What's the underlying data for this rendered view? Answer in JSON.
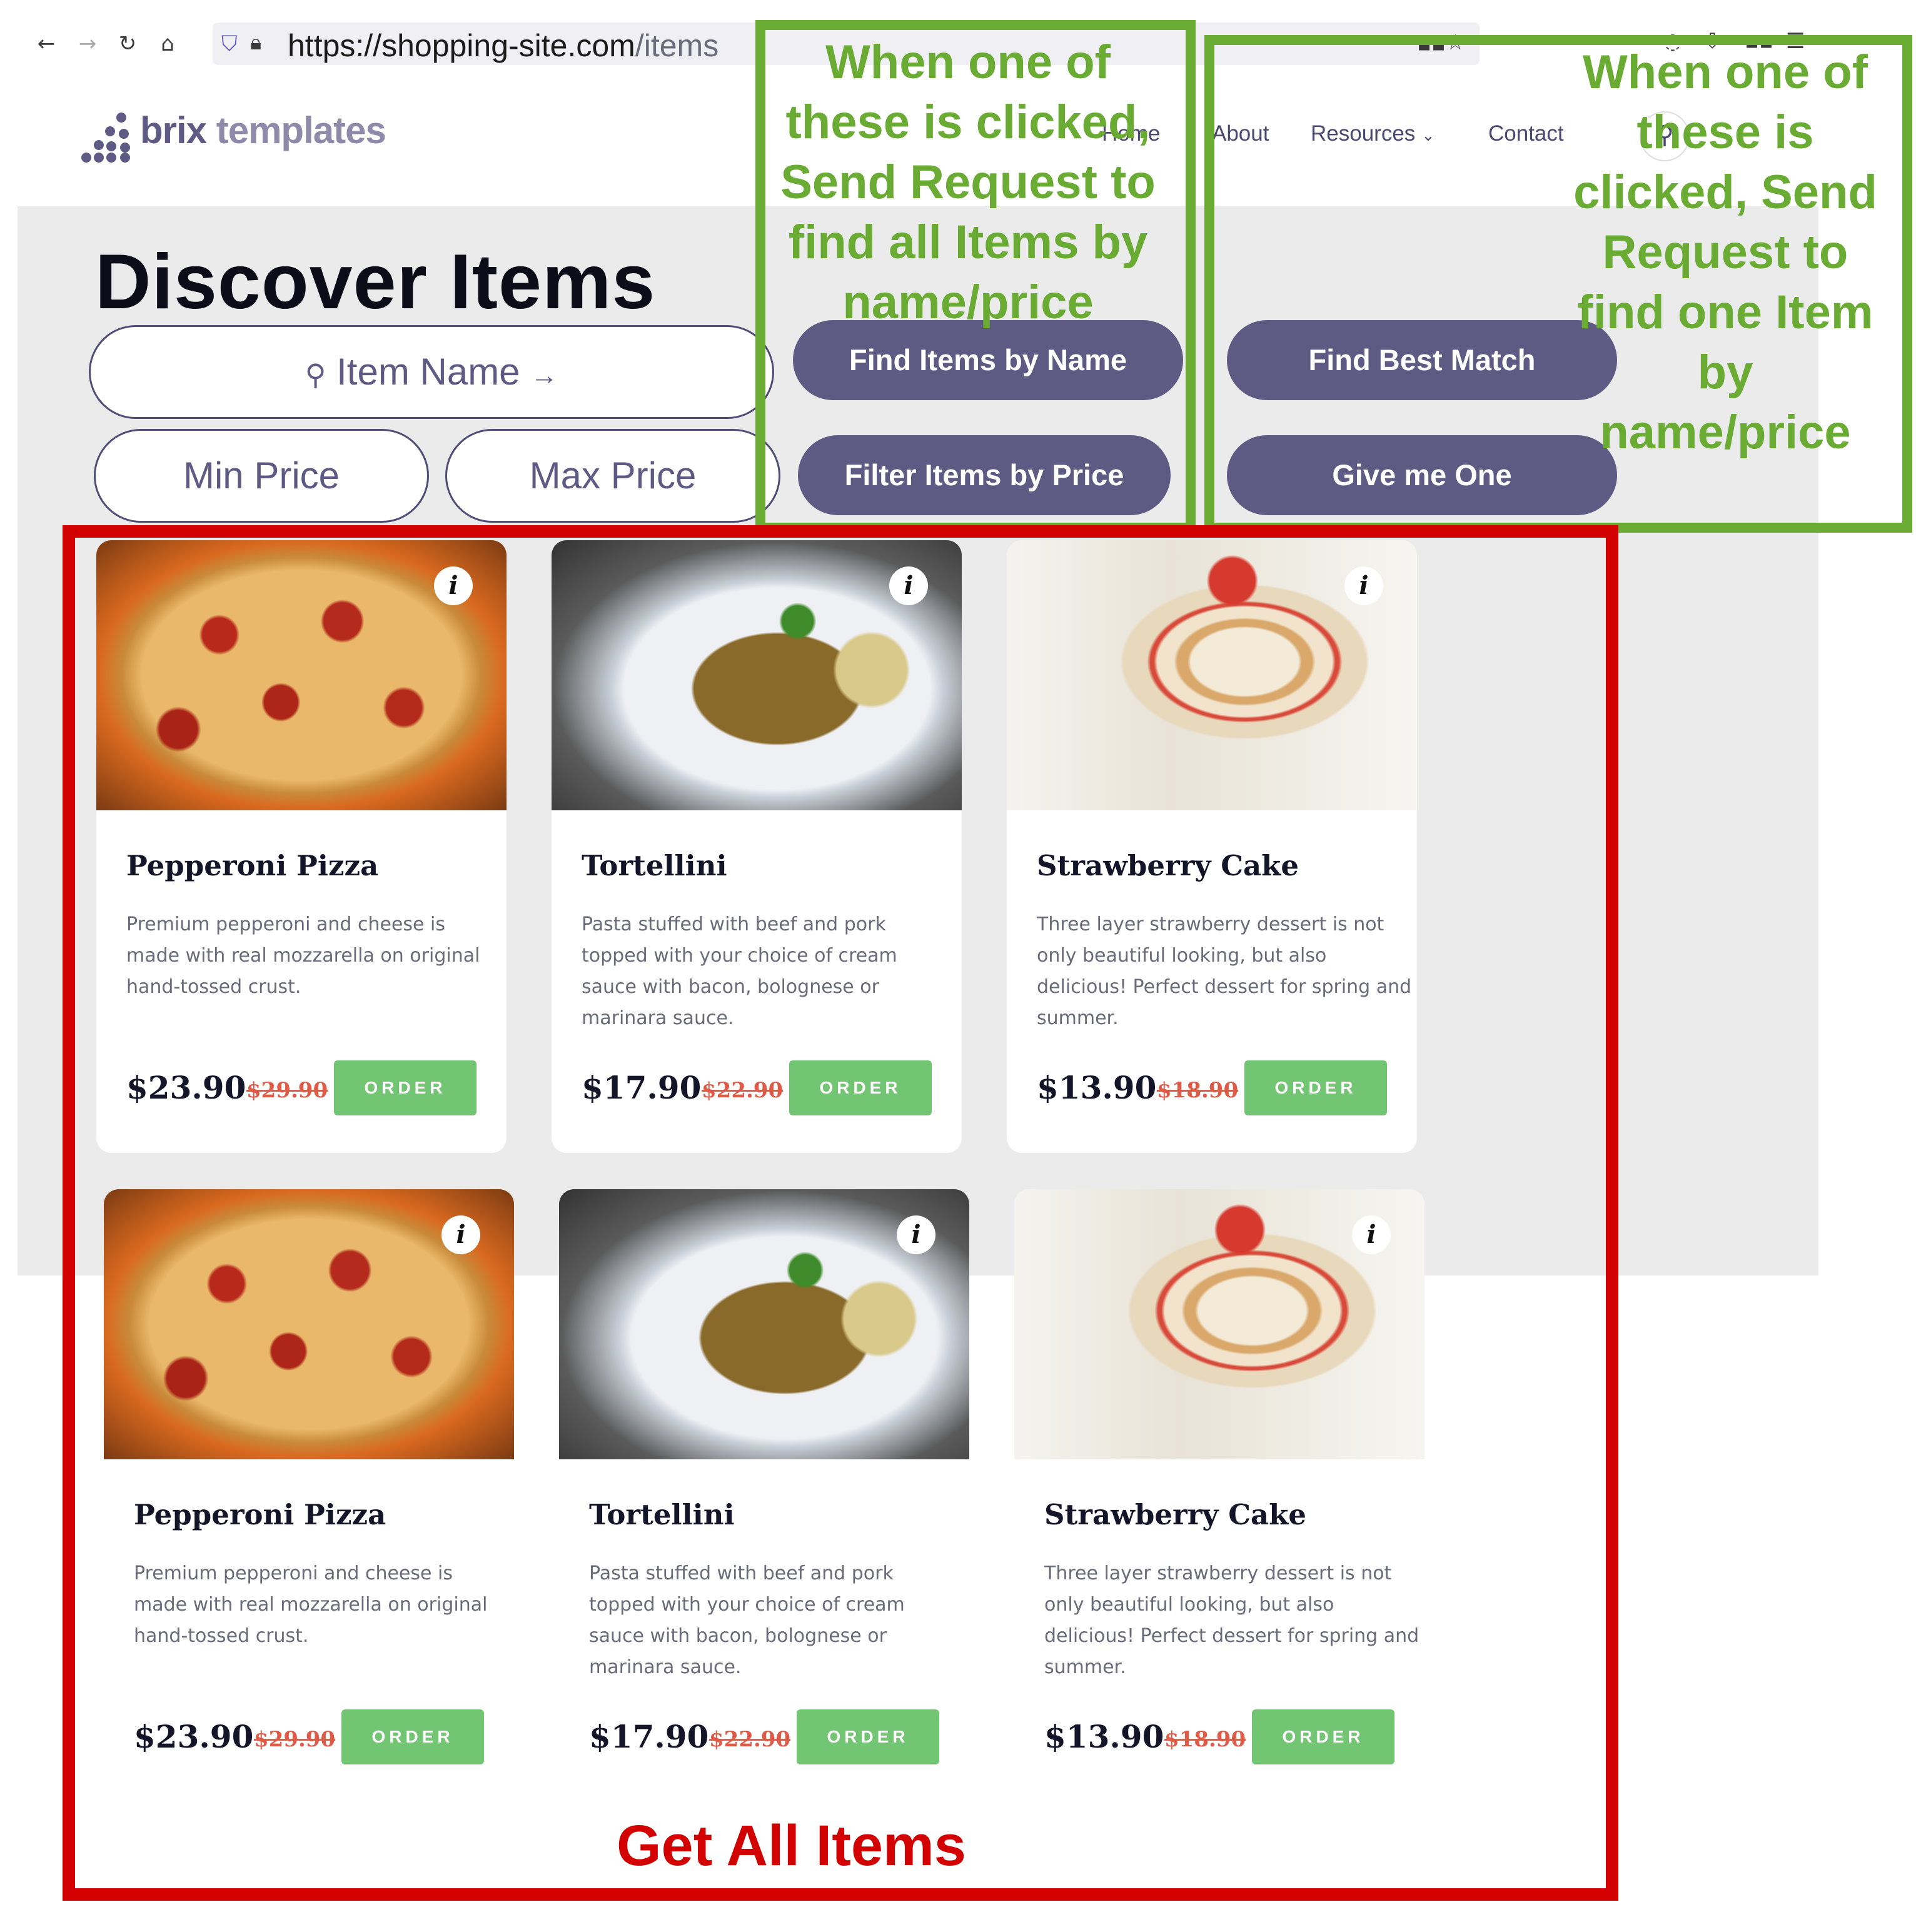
{
  "browser": {
    "url_host": "https://shopping-site.com",
    "url_path": "/items"
  },
  "header": {
    "logo_bold": "brix",
    "logo_light": "templates",
    "nav": [
      "Home",
      "About",
      "Resources",
      "Contact"
    ]
  },
  "main": {
    "title": "Discover Items",
    "item_name_placeholder": "Item Name",
    "min_price_placeholder": "Min Price",
    "max_price_placeholder": "Max Price",
    "buttons": {
      "find_by_name": "Find Items by Name",
      "filter_by_price": "Filter Items by Price",
      "find_best_match": "Find Best Match",
      "give_me_one": "Give me One"
    }
  },
  "annotations": {
    "green_1": "When one of these is clicked, Send Request to find all Items by name/price",
    "green_2": "When one of these is clicked, Send Request to find one Item by name/price",
    "red": "Get All Items"
  },
  "items": [
    {
      "name": "Pepperoni Pizza",
      "desc": "Premium pepperoni and cheese is made with real mozzarella on original hand-tossed crust.",
      "price": "$23.90",
      "old_price": "$29.90",
      "order": "ORDER",
      "info": "i"
    },
    {
      "name": "Tortellini",
      "desc": "Pasta stuffed with beef and pork topped with your choice of cream sauce with bacon, bolognese or marinara sauce.",
      "price": "$17.90",
      "old_price": "$22.90",
      "order": "ORDER",
      "info": "i"
    },
    {
      "name": "Strawberry Cake",
      "desc": "Three layer strawberry dessert is not only beautiful looking, but also delicious! Perfect dessert for spring and summer.",
      "price": "$13.90",
      "old_price": "$18.90",
      "order": "ORDER",
      "info": "i"
    },
    {
      "name": "Pepperoni Pizza",
      "desc": "Premium pepperoni and cheese is made with real mozzarella on original hand-tossed crust.",
      "price": "$23.90",
      "old_price": "$29.90",
      "order": "ORDER",
      "info": "i"
    },
    {
      "name": "Tortellini",
      "desc": "Pasta stuffed with beef and pork topped with your choice of cream sauce with bacon, bolognese or marinara sauce.",
      "price": "$17.90",
      "old_price": "$22.90",
      "order": "ORDER",
      "info": "i"
    },
    {
      "name": "Strawberry Cake",
      "desc": "Three layer strawberry dessert is not only beautiful looking, but also delicious! Perfect dessert for spring and summer.",
      "price": "$13.90",
      "old_price": "$18.90",
      "order": "ORDER",
      "info": "i"
    }
  ],
  "colors": {
    "brand": "#5f5a84",
    "annotation_green": "#6aab34",
    "annotation_red": "#d30000",
    "order_green": "#72c572",
    "old_price_red": "#e05a47"
  }
}
